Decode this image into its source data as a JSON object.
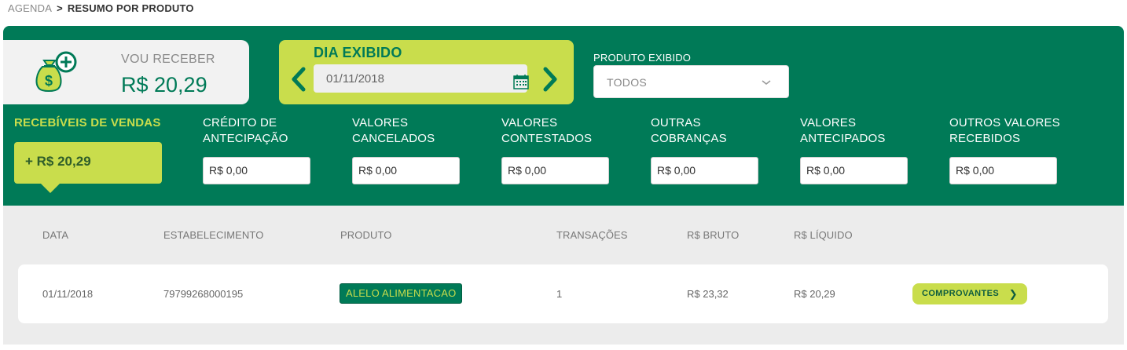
{
  "breadcrumb": {
    "parent": "AGENDA",
    "separator": ">",
    "current": "RESUMO POR PRODUTO"
  },
  "receive": {
    "label": "VOU RECEBER",
    "value": "R$ 20,29"
  },
  "day": {
    "title": "DIA EXIBIDO",
    "date": "01/11/2018"
  },
  "product": {
    "label": "PRODUTO EXIBIDO",
    "selected": "TODOS"
  },
  "categories": {
    "sales": {
      "label": "RECEBÍVEIS DE VENDAS",
      "value": "+ R$ 20,29"
    },
    "items": [
      {
        "line1": "CRÉDITO DE",
        "line2": "ANTECIPAÇÃO",
        "value": "R$ 0,00"
      },
      {
        "line1": "VALORES",
        "line2": "CANCELADOS",
        "value": "R$ 0,00"
      },
      {
        "line1": "VALORES",
        "line2": "CONTESTADOS",
        "value": "R$ 0,00"
      },
      {
        "line1": "OUTRAS",
        "line2": "COBRANÇAS",
        "value": "R$ 0,00"
      },
      {
        "line1": "VALORES",
        "line2": "ANTECIPADOS",
        "value": "R$ 0,00"
      },
      {
        "line1": "OUTROS VALORES",
        "line2": "RECEBIDOS",
        "value": "R$ 0,00"
      }
    ]
  },
  "table": {
    "headers": [
      "DATA",
      "ESTABELECIMENTO",
      "PRODUTO",
      "TRANSAÇÕES",
      "R$ BRUTO",
      "R$ LÍQUIDO"
    ],
    "rows": [
      {
        "date": "01/11/2018",
        "establishment": "79799268000195",
        "product": "ALELO ALIMENTACAO",
        "transactions": "1",
        "gross": "R$ 23,32",
        "net": "R$ 20,29",
        "action": "COMPROVANTES"
      }
    ]
  },
  "colors": {
    "green": "#007a57",
    "lime": "#c9dd4c",
    "gray_bg": "#ececec"
  },
  "icons": [
    "money-bag-plus-icon",
    "chevron-left-icon",
    "chevron-right-icon",
    "calendar-icon",
    "chevron-down-icon"
  ]
}
